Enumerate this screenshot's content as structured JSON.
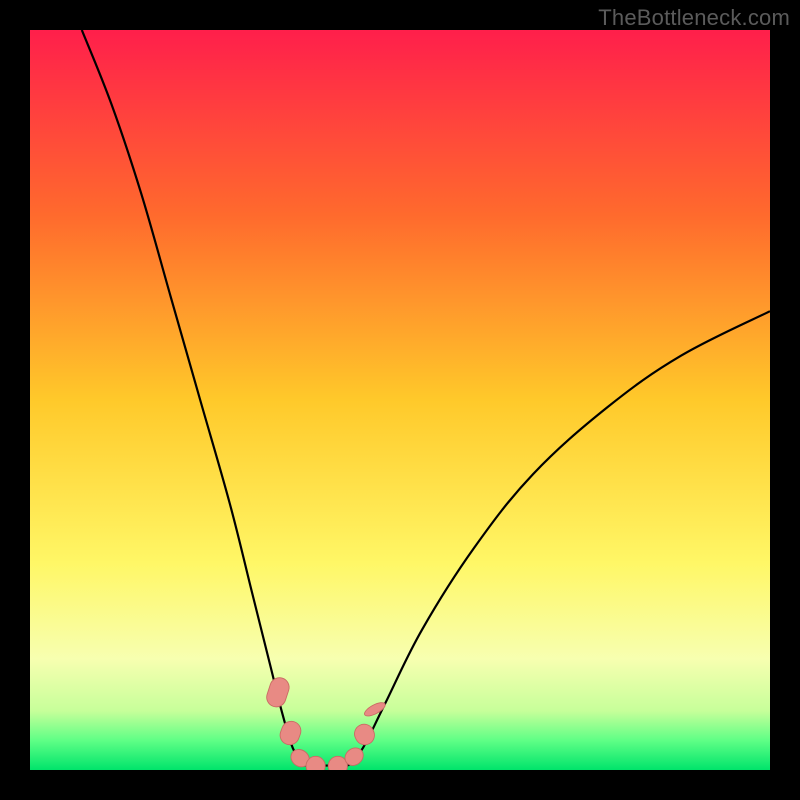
{
  "watermark": "TheBottleneck.com",
  "colors": {
    "background": "#000000",
    "curve_stroke": "#000000",
    "marker_fill": "#e88a84",
    "marker_stroke": "#c96b64"
  },
  "chart_data": {
    "type": "line",
    "title": "",
    "xlabel": "",
    "ylabel": "",
    "xlim": [
      0,
      100
    ],
    "ylim": [
      0,
      100
    ],
    "gradient_stops": [
      {
        "offset": 0,
        "color": "#ff1f4b"
      },
      {
        "offset": 25,
        "color": "#ff6a2d"
      },
      {
        "offset": 50,
        "color": "#ffc92a"
      },
      {
        "offset": 72,
        "color": "#fff766"
      },
      {
        "offset": 85,
        "color": "#f7ffb0"
      },
      {
        "offset": 92,
        "color": "#c7ff9a"
      },
      {
        "offset": 96,
        "color": "#5fff86"
      },
      {
        "offset": 100,
        "color": "#00e46b"
      }
    ],
    "series": [
      {
        "name": "left-curve",
        "points": [
          {
            "x": 7,
            "y": 100
          },
          {
            "x": 11,
            "y": 90
          },
          {
            "x": 15,
            "y": 78
          },
          {
            "x": 19,
            "y": 64
          },
          {
            "x": 23,
            "y": 50
          },
          {
            "x": 27,
            "y": 36
          },
          {
            "x": 30,
            "y": 24
          },
          {
            "x": 32.5,
            "y": 14
          },
          {
            "x": 34,
            "y": 8
          },
          {
            "x": 35.5,
            "y": 3
          },
          {
            "x": 37,
            "y": 0.6
          }
        ]
      },
      {
        "name": "right-curve",
        "points": [
          {
            "x": 43,
            "y": 0.6
          },
          {
            "x": 45,
            "y": 3
          },
          {
            "x": 48,
            "y": 9
          },
          {
            "x": 53,
            "y": 19
          },
          {
            "x": 60,
            "y": 30
          },
          {
            "x": 68,
            "y": 40
          },
          {
            "x": 78,
            "y": 49
          },
          {
            "x": 88,
            "y": 56
          },
          {
            "x": 100,
            "y": 62
          }
        ]
      },
      {
        "name": "valley-floor",
        "points": [
          {
            "x": 37,
            "y": 0.6
          },
          {
            "x": 43,
            "y": 0.6
          }
        ]
      }
    ],
    "markers": [
      {
        "x": 33.5,
        "y": 10.5,
        "len": 4.0,
        "angle": -72,
        "r": 1.3
      },
      {
        "x": 35.2,
        "y": 5.0,
        "len": 3.2,
        "angle": -70,
        "r": 1.3
      },
      {
        "x": 36.5,
        "y": 1.6,
        "len": 2.2,
        "angle": -55,
        "r": 1.3
      },
      {
        "x": 38.6,
        "y": 0.55,
        "len": 2.6,
        "angle": 0,
        "r": 1.3
      },
      {
        "x": 41.6,
        "y": 0.55,
        "len": 2.6,
        "angle": 0,
        "r": 1.3
      },
      {
        "x": 43.8,
        "y": 1.8,
        "len": 2.2,
        "angle": 52,
        "r": 1.3
      },
      {
        "x": 45.2,
        "y": 4.8,
        "len": 2.8,
        "angle": 62,
        "r": 1.3
      },
      {
        "x": 46.6,
        "y": 8.2,
        "len": 1.2,
        "angle": 62,
        "r": 1.55
      }
    ]
  }
}
